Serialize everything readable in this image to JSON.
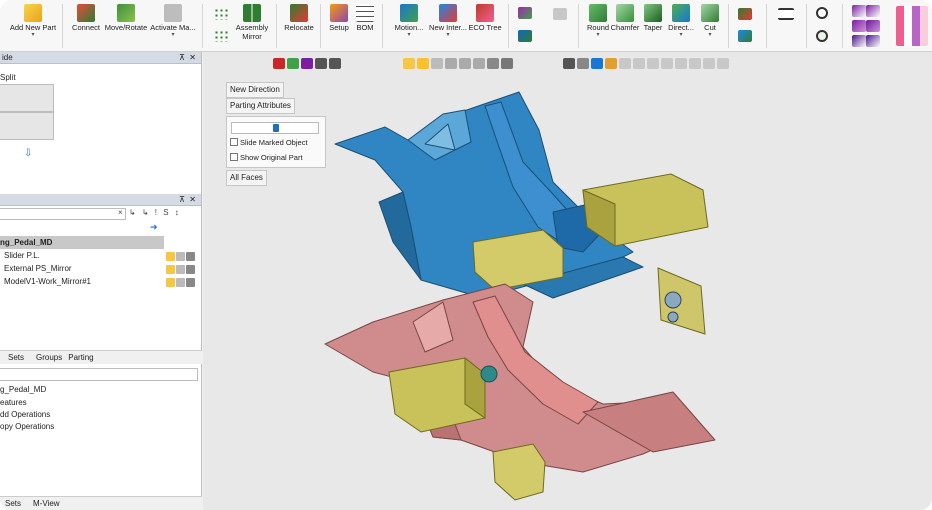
{
  "ribbon": {
    "add_new_part": "Add New Part",
    "connect": "Connect",
    "move_rotate": "Move/Rotate",
    "activate": "Activate Ma...",
    "assembly_mirror": "Assembly Mirror",
    "relocate": "Relocate",
    "setup": "Setup",
    "bom": "BOM",
    "motion": "Motion...",
    "new_inter": "New Inter...",
    "eco_tree": "ECO Tree",
    "round": "Round",
    "chamfer": "Chamfer",
    "taper": "Taper",
    "direct": "Direct...",
    "cut": "Cut"
  },
  "slide_panel": {
    "title": "ide",
    "split_label": "Split"
  },
  "tree_panel": {
    "root": "ng_Pedal_MD",
    "items": [
      "Slider P.L.",
      "External PS_Mirror",
      "ModelV1-Work_Mirror#1"
    ],
    "search_icons": "× ↳ ↳ ! S ↕"
  },
  "mid_tabs": {
    "sets": "Sets",
    "groups": "Groups",
    "parting": "Parting"
  },
  "ops_panel": {
    "root": "g_Pedal_MD",
    "items": [
      "eatures",
      "dd Operations",
      "opy Operations"
    ]
  },
  "bottom_tabs": {
    "sets": "Sets",
    "mview": "M-View"
  },
  "viewport": {
    "new_direction": "New Direction",
    "parting_attributes": "Parting Attributes",
    "slide_marked": "Slide Marked Object",
    "show_original": "Show Original Part",
    "all_faces": "All Faces",
    "slider_value": 0.5
  },
  "colors": {
    "blue_part": "#2f86c2",
    "pink_part": "#d08c8c",
    "yellow_part": "#c9c15a",
    "viewport_bg": "#e8e8e8"
  }
}
